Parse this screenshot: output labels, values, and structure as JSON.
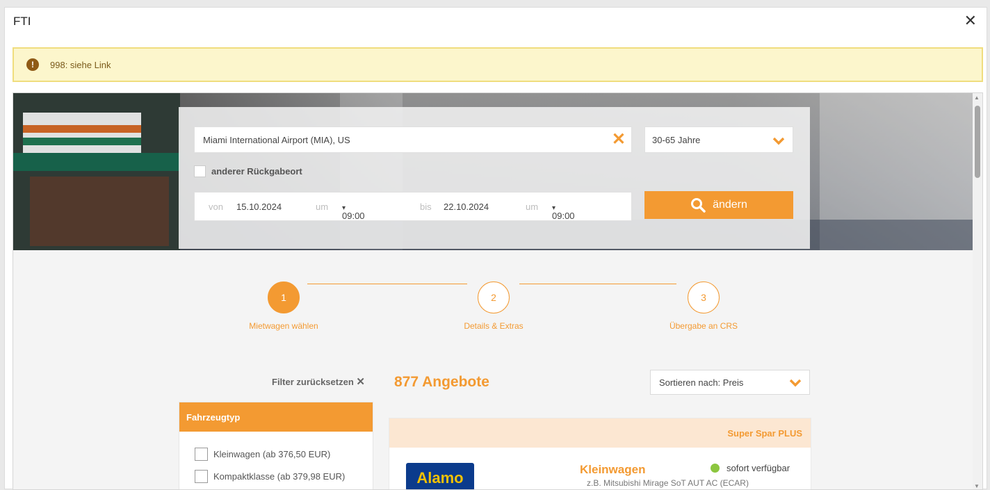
{
  "dialog": {
    "title": "FTI",
    "close_icon": "close-icon",
    "alert": {
      "icon": "exclamation-icon",
      "text": "998: siehe Link"
    }
  },
  "search": {
    "location": "Miami International Airport (MIA), US",
    "age": "30-65 Jahre",
    "other_return_label": "anderer Rückgabeort",
    "from_label": "von",
    "from_date": "15.10.2024",
    "at_label": "um",
    "from_time": "09:00",
    "to_label": "bis",
    "to_date": "22.10.2024",
    "to_time": "09:00",
    "button_label": "ändern"
  },
  "steps": [
    {
      "number": "1",
      "label": "Mietwagen wählen"
    },
    {
      "number": "2",
      "label": "Details & Extras"
    },
    {
      "number": "3",
      "label": "Übergabe an CRS"
    }
  ],
  "results": {
    "filter_reset": "Filter zurücksetzen",
    "offers_count": "877 Angebote",
    "sort_label": "Sortieren nach: Preis"
  },
  "filters": {
    "title": "Fahrzeugtyp",
    "items": [
      "Kleinwagen (ab 376,50 EUR)",
      "Kompaktklasse (ab 379,98 EUR)"
    ]
  },
  "offer": {
    "banner": "Super Spar PLUS",
    "vendor": "Alamo",
    "car_class": "Kleinwagen",
    "model": "z.B. Mitsubishi Mirage SoT AUT AC (ECAR)",
    "availability": "sofort verfügbar"
  },
  "colors": {
    "accent": "#f39a32",
    "alert_bg": "#fcf6cc",
    "available": "#8cc63f"
  }
}
